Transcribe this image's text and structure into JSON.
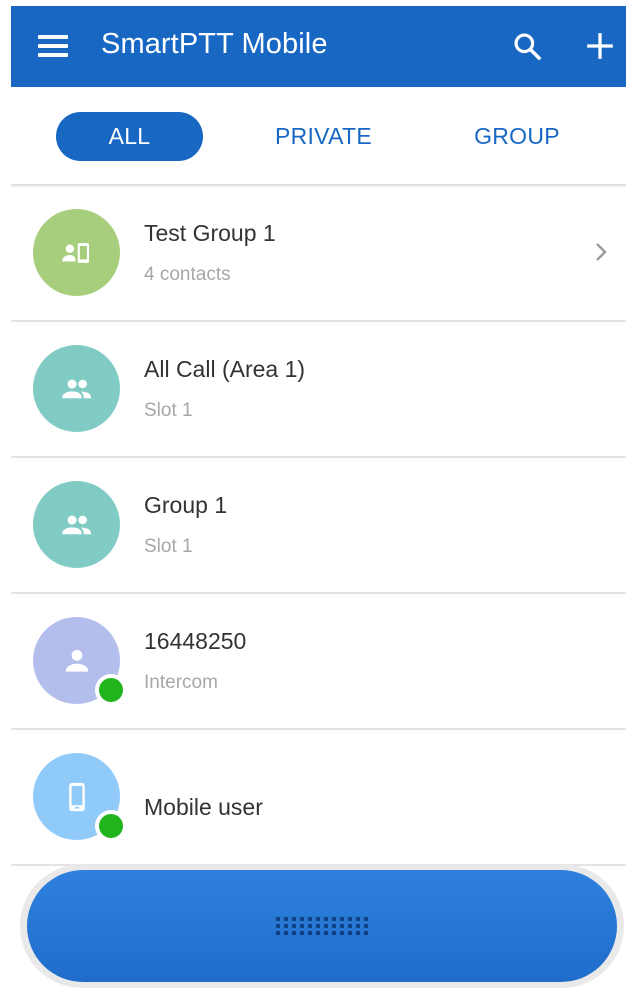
{
  "app": {
    "title": "SmartPTT Mobile",
    "accent_color": "#1767C3"
  },
  "toolbar": {
    "menu_icon": "hamburger-menu-icon",
    "search_icon": "search-icon",
    "add_icon": "plus-icon"
  },
  "tabs": [
    {
      "label": "ALL",
      "active": true
    },
    {
      "label": "PRIVATE",
      "active": false
    },
    {
      "label": "GROUP",
      "active": false
    }
  ],
  "contacts": [
    {
      "title": "Test Group 1",
      "subtitle": "4 contacts",
      "icon": "group-mixed-icon",
      "avatar_color": "#A6CE7C",
      "online": false,
      "has_chevron": true
    },
    {
      "title": "All Call (Area 1)",
      "subtitle": "Slot 1",
      "icon": "people-icon",
      "avatar_color": "#80CBC4",
      "online": false,
      "has_chevron": false
    },
    {
      "title": "Group 1",
      "subtitle": "Slot 1",
      "icon": "people-icon",
      "avatar_color": "#80CBC4",
      "online": false,
      "has_chevron": false
    },
    {
      "title": "16448250",
      "subtitle": "Intercom",
      "icon": "person-icon",
      "avatar_color": "#B4BEEC",
      "online": true,
      "has_chevron": false
    },
    {
      "title": "Mobile user",
      "subtitle": "",
      "icon": "mobile-phone-icon",
      "avatar_color": "#90CAF9",
      "online": true,
      "has_chevron": false
    }
  ],
  "status_colors": {
    "online": "#22B51E"
  },
  "ptt_button": {
    "icon": "grip-dots-icon"
  }
}
